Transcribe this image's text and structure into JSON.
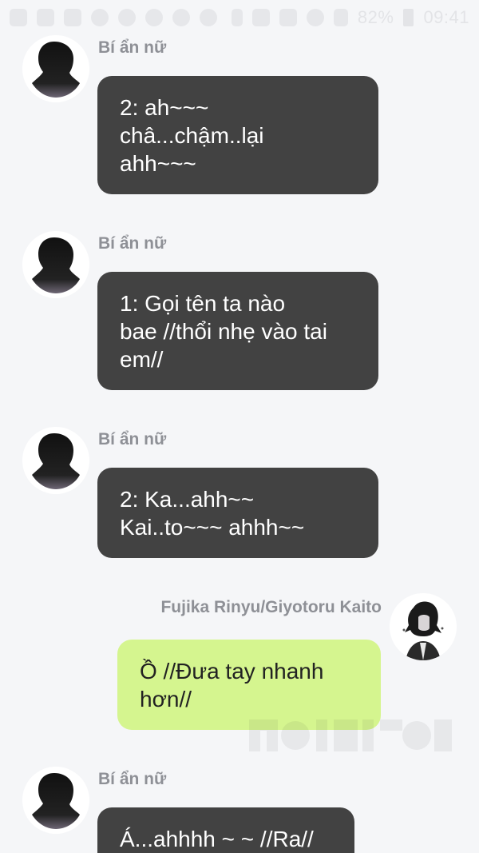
{
  "status_bar": {
    "battery_percent": "82%",
    "time": "09:41",
    "left_icons": [
      "message-icon",
      "image-icon",
      "chat-icon",
      "pinterest-icon",
      "app-icon",
      "app-icon",
      "app-icon",
      "app-icon"
    ],
    "right_icons": [
      "vibrate-icon",
      "mute-icon",
      "data-icon",
      "wifi-icon",
      "signal-icon"
    ]
  },
  "messages": [
    {
      "side": "left",
      "sender": "Bí ẩn nữ",
      "text": "2: ah~~~\nchâ...chậm..lại\nahh~~~"
    },
    {
      "side": "left",
      "sender": "Bí ẩn nữ",
      "text": "1: Gọi tên ta nào\nbae //thổi nhẹ vào tai\nem//"
    },
    {
      "side": "left",
      "sender": "Bí ẩn nữ",
      "text": "2: Ka...ahh~~\nKai..to~~~ ahhh~~"
    },
    {
      "side": "right",
      "sender": "Fujika Rinyu/Giyotoru Kaito",
      "text": "Ồ //Đưa tay nhanh\nhơn//"
    },
    {
      "side": "left",
      "sender": "Bí ẩn nữ",
      "text": "Á...ahhhh ~ ~ //Ra//"
    }
  ],
  "colors": {
    "background": "#f5f6f8",
    "bubble_dark": "#424242",
    "bubble_light": "#d5f58f",
    "sender": "#8e9096"
  }
}
